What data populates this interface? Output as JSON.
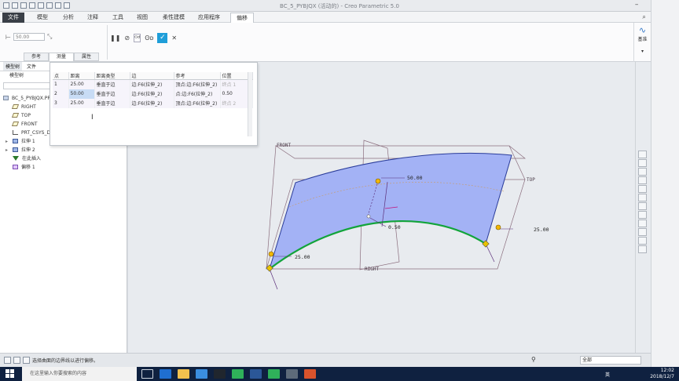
{
  "window": {
    "title": "BC_5_PYBJQX (活动的) - Creo Parametric 5.0"
  },
  "menu": {
    "file": "文件",
    "tabs": [
      "模型",
      "分析",
      "注释",
      "工具",
      "视图",
      "柔性建模",
      "应用程序",
      "偏移"
    ],
    "active_tab": "偏移"
  },
  "ribbon": {
    "value_placeholder": "50.00",
    "right_label": "基准"
  },
  "subtabs": {
    "items": [
      "参考",
      "测量",
      "属性"
    ],
    "active": "测量"
  },
  "left_panel": {
    "tab_model_tree": "模型树",
    "tab_files": "文件",
    "header": "模型树",
    "tree": [
      {
        "label": "BC_5_PYBJQX.PRT",
        "kind": "part"
      },
      {
        "label": "RIGHT",
        "kind": "plane"
      },
      {
        "label": "TOP",
        "kind": "plane"
      },
      {
        "label": "FRONT",
        "kind": "plane"
      },
      {
        "label": "PRT_CSYS_DEF",
        "kind": "csys"
      },
      {
        "label": "拉伸 1",
        "kind": "feat"
      },
      {
        "label": "拉伸 2",
        "kind": "feat"
      },
      {
        "label": "在此插入",
        "kind": "ins"
      },
      {
        "label": "偏移 1",
        "kind": "off"
      }
    ]
  },
  "measure_table": {
    "headers": [
      "点",
      "距离",
      "距离类型",
      "边",
      "参考",
      "位置"
    ],
    "rows": [
      [
        "1",
        "25.00",
        "垂直于边",
        "边:F6(拉伸_2)",
        "顶点:边:F6(拉伸_2)",
        "终点 1"
      ],
      [
        "2",
        "50.00",
        "垂直于边",
        "边:F6(拉伸_2)",
        "点:边:F6(拉伸_2)",
        "0.50"
      ],
      [
        "3",
        "25.00",
        "垂直于边",
        "边:F6(拉伸_2)",
        "顶点:边:F6(拉伸_2)",
        "终点 2"
      ]
    ]
  },
  "graphics": {
    "labels": {
      "front": "FRONT",
      "top": "TOP",
      "right": "RIGHT",
      "dim_mid": "50.00",
      "dim_left": "25.00",
      "dim_right": "25.00",
      "dim_ratio": "0.50"
    },
    "colors": {
      "surface": "#a3b2f5",
      "surface_edge": "#2a3c9a",
      "edge_selected": "#12a43a",
      "handle": "#f2b705"
    }
  },
  "status": {
    "message": "选择曲面的边界线以进行偏移。",
    "filter_value": "全部"
  },
  "taskbar": {
    "search_placeholder": "在这里输入你要搜索的内容",
    "time": "12:02",
    "date": "2018/12/7",
    "ime": "英"
  }
}
